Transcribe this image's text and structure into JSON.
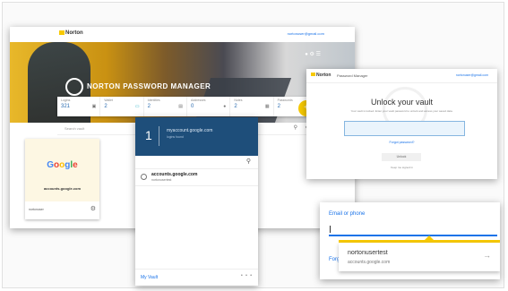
{
  "main": {
    "brand": "Norton",
    "account_email": "nortonuser@gmail.com",
    "hero_title": "NORTON PASSWORD MANAGER",
    "filters": [
      {
        "label": "Logins",
        "value": "321",
        "icon": "key-icon"
      },
      {
        "label": "Wallet",
        "value": "2",
        "icon": "card-icon"
      },
      {
        "label": "Identities",
        "value": "2",
        "icon": "id-icon"
      },
      {
        "label": "Addresses",
        "value": "0",
        "icon": "pin-icon"
      },
      {
        "label": "Notes",
        "value": "2",
        "icon": "note-icon"
      },
      {
        "label": "Passwords",
        "value": "2",
        "icon": "lock-icon"
      }
    ],
    "search_placeholder": "Search vault",
    "tile": {
      "logo": "Google",
      "domain": "accounts.google.com",
      "username": "nortonuser"
    }
  },
  "popup": {
    "count": "1",
    "title": "myaccount.google.com",
    "subtitle": "logins found",
    "items": [
      {
        "domain": "accounts.google.com",
        "username": "nortonusertest"
      }
    ],
    "footer_link": "My Vault",
    "footer_dots": "• • •"
  },
  "unlock": {
    "brand": "Norton",
    "tab_label": "Password Manager",
    "account": "nortonuser@gmail.com",
    "title": "Unlock your vault",
    "description": "Your vault is locked. Enter your vault password to unlock and access your saved data.",
    "forgot_link": "Forgot password?",
    "button": "Unlock",
    "keep": "Keep me signed in"
  },
  "autofill": {
    "field_label": "Email or phone",
    "suggestion_user": "nortonusertest",
    "suggestion_domain": "accounts.google.com",
    "forgot_prefix": "Forg"
  }
}
